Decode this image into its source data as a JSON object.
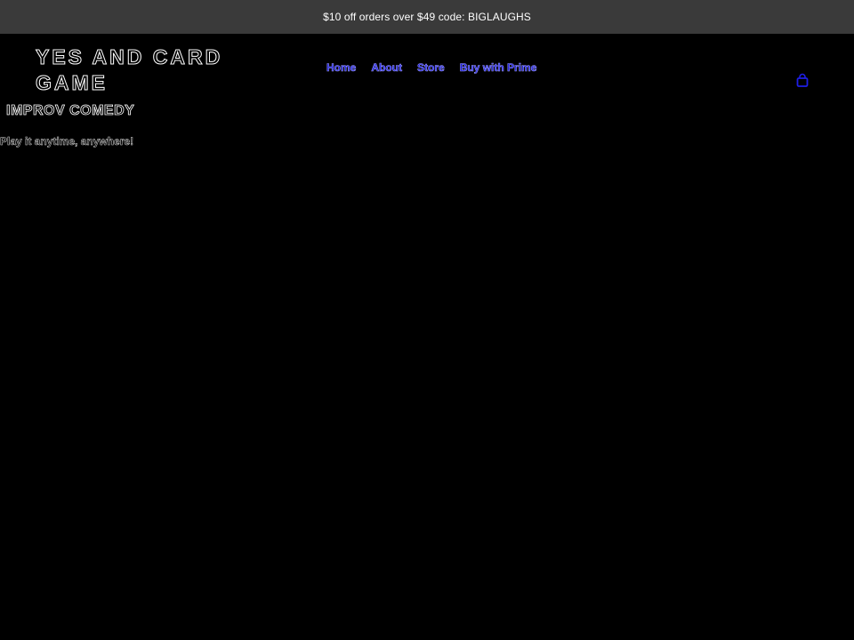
{
  "announcement": {
    "text": "$10 off orders over $49 code: BIGLAUGHS"
  },
  "header": {
    "brand": "YES AND CARD GAME",
    "nav": [
      {
        "label": "Home"
      },
      {
        "label": "About"
      },
      {
        "label": "Store"
      },
      {
        "label": "Buy with Prime"
      }
    ],
    "cart_icon": "shopping-bag-icon"
  },
  "hero": {
    "tagline": "IMPROV COMEDY",
    "subtitle": "Play it anytime, anywhere!"
  },
  "colors": {
    "page_background": "#000000",
    "announcement_background": "#3a3a3a",
    "nav_link": "#1b1bd8",
    "cart_icon": "#1e1ee6"
  }
}
